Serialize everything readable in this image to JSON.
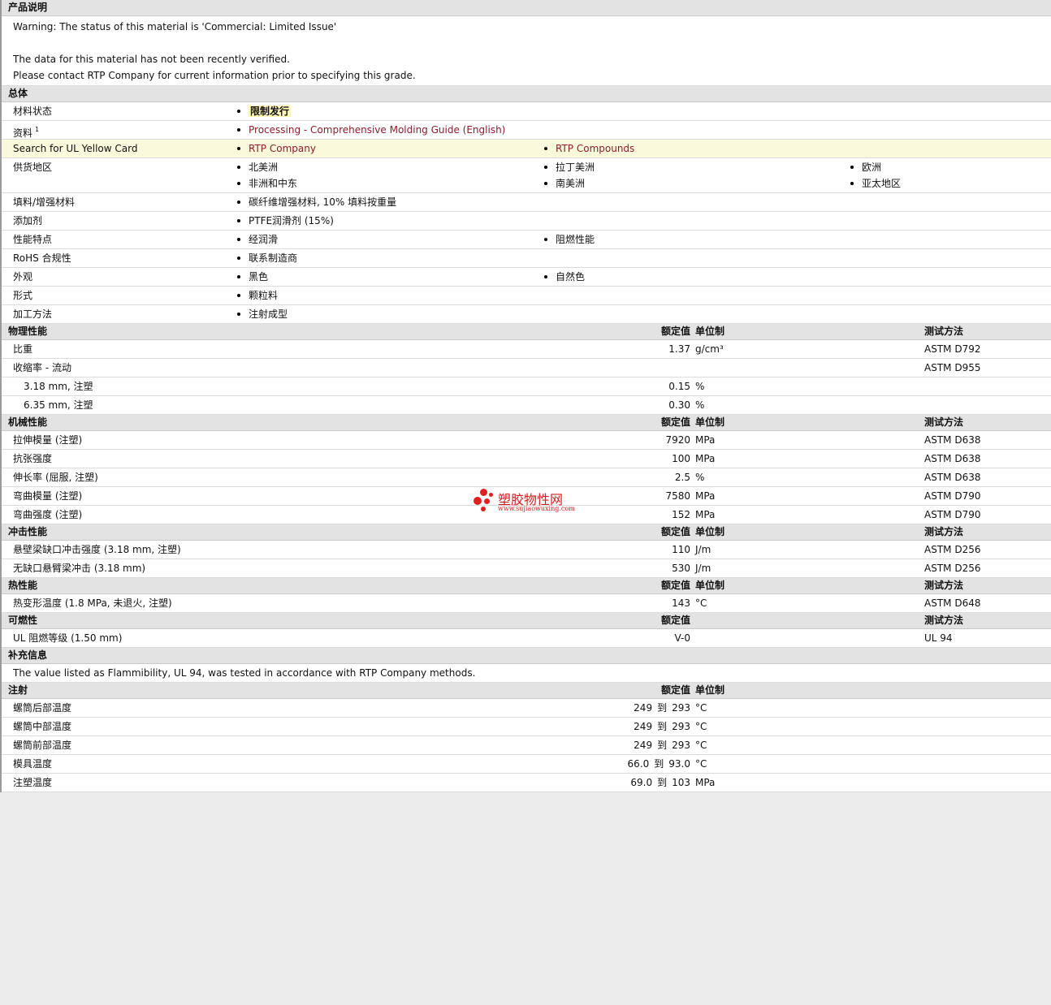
{
  "desc": {
    "heading": "产品说明",
    "warning": "Warning: The status of this material is 'Commercial: Limited Issue'",
    "verify1": "The data for this material has not been recently verified.",
    "verify2": "Please contact RTP Company for current information prior to specifying this grade."
  },
  "general": {
    "heading": "总体",
    "status_label": "材料状态",
    "status_value": "限制发行",
    "docs_label": "资料",
    "docs_sup": "1",
    "docs_link": "Processing - Comprehensive Molding Guide (English)",
    "ul_label": "Search for UL Yellow Card",
    "ul_link1": "RTP Company",
    "ul_link2": "RTP Compounds",
    "supply_label": "供货地区",
    "supply": [
      "北美洲",
      "拉丁美洲",
      "欧洲",
      "非洲和中东",
      "南美洲",
      "亚太地区"
    ],
    "filler_label": "填料/增强材料",
    "filler": "碳纤维增强材料, 10% 填料按重量",
    "additive_label": "添加剂",
    "additive": "PTFE润滑剂 (15%)",
    "features_label": "性能特点",
    "features": [
      "经润滑",
      "阻燃性能"
    ],
    "rohs_label": "RoHS 合规性",
    "rohs": "联系制造商",
    "appearance_label": "外观",
    "appearance": [
      "黑色",
      "自然色"
    ],
    "form_label": "形式",
    "form": "颗粒料",
    "process_label": "加工方法",
    "process": "注射成型"
  },
  "hdr": {
    "value": "额定值",
    "unit": "单位制",
    "method": "测试方法"
  },
  "physical": {
    "heading": "物理性能",
    "rows": [
      {
        "label": "比重",
        "value": "1.37",
        "unit": "g/cm³",
        "method": "ASTM D792"
      },
      {
        "label": "收缩率 - 流动",
        "value": "",
        "unit": "",
        "method": "ASTM D955"
      },
      {
        "label": "3.18 mm, 注塑",
        "value": "0.15",
        "unit": "%",
        "method": ""
      },
      {
        "label": "6.35 mm, 注塑",
        "value": "0.30",
        "unit": "%",
        "method": ""
      }
    ]
  },
  "mechanical": {
    "heading": "机械性能",
    "rows": [
      {
        "label": "拉伸模量 (注塑)",
        "value": "7920",
        "unit": "MPa",
        "method": "ASTM D638"
      },
      {
        "label": "抗张强度",
        "value": "100",
        "unit": "MPa",
        "method": "ASTM D638"
      },
      {
        "label": "伸长率 (屈服, 注塑)",
        "value": "2.5",
        "unit": "%",
        "method": "ASTM D638"
      },
      {
        "label": "弯曲模量 (注塑)",
        "value": "7580",
        "unit": "MPa",
        "method": "ASTM D790"
      },
      {
        "label": "弯曲强度 (注塑)",
        "value": "152",
        "unit": "MPa",
        "method": "ASTM D790"
      }
    ]
  },
  "impact": {
    "heading": "冲击性能",
    "rows": [
      {
        "label": "悬壁梁缺口冲击强度 (3.18 mm, 注塑)",
        "value": "110",
        "unit": "J/m",
        "method": "ASTM D256"
      },
      {
        "label": "无缺口悬臂梁冲击 (3.18 mm)",
        "value": "530",
        "unit": "J/m",
        "method": "ASTM D256"
      }
    ]
  },
  "thermal": {
    "heading": "热性能",
    "rows": [
      {
        "label": "热变形温度 (1.8 MPa, 未退火, 注塑)",
        "value": "143",
        "unit": "°C",
        "method": "ASTM D648"
      }
    ]
  },
  "flammability": {
    "heading": "可燃性",
    "rows": [
      {
        "label": "UL 阻燃等级 (1.50 mm)",
        "value": "V-0",
        "unit": "",
        "method": "UL 94"
      }
    ]
  },
  "supplement": {
    "heading": "补充信息",
    "text": "The value listed as Flammibility, UL 94, was tested in accordance with RTP Company methods."
  },
  "injection": {
    "heading": "注射",
    "to": "到",
    "rows": [
      {
        "label": "螺筒后部温度",
        "from": "249",
        "to_val": "293",
        "unit": "°C"
      },
      {
        "label": "螺筒中部温度",
        "from": "249",
        "to_val": "293",
        "unit": "°C"
      },
      {
        "label": "螺筒前部温度",
        "from": "249",
        "to_val": "293",
        "unit": "°C"
      },
      {
        "label": "模具温度",
        "from": "66.0",
        "to_val": "93.0",
        "unit": "°C"
      },
      {
        "label": "注塑温度",
        "from": "69.0",
        "to_val": "103",
        "unit": "MPa"
      }
    ]
  },
  "watermark": {
    "title": "塑胶物性网",
    "url": "www.sujiaowuxing.com"
  }
}
